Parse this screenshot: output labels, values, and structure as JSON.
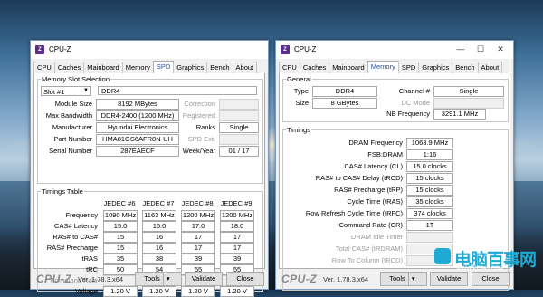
{
  "left": {
    "title": "CPU-Z",
    "tabs": [
      "CPU",
      "Caches",
      "Mainboard",
      "Memory",
      "SPD",
      "Graphics",
      "Bench",
      "About"
    ],
    "active_tab": "SPD",
    "slot_section": "Memory Slot Selection",
    "slot": {
      "value": "Slot #1",
      "type": "DDR4"
    },
    "labels": {
      "module_size": "Module Size",
      "max_bandwidth": "Max Bandwidth",
      "manufacturer": "Manufacturer",
      "part_number": "Part Number",
      "serial_number": "Serial Number",
      "correction": "Correction",
      "registered": "Registered",
      "ranks": "Ranks",
      "spd_ext": "SPD Ext.",
      "week_year": "Week/Year"
    },
    "values": {
      "module_size": "8192 MBytes",
      "max_bandwidth": "DDR4-2400 (1200 MHz)",
      "manufacturer": "Hyundai Electronics",
      "part_number": "HMA81GS6AFR8N-UH",
      "serial_number": "287EAECF",
      "ranks": "Single",
      "week_year": "01 / 17"
    },
    "timings_section": "Timings Table",
    "timing_headers": [
      "JEDEC #6",
      "JEDEC #7",
      "JEDEC #8",
      "JEDEC #9"
    ],
    "timing_rows": [
      {
        "label": "Frequency",
        "values": [
          "1090 MHz",
          "1163 MHz",
          "1200 MHz",
          "1200 MHz"
        ],
        "dim": false
      },
      {
        "label": "CAS# Latency",
        "values": [
          "15.0",
          "16.0",
          "17.0",
          "18.0"
        ],
        "dim": false
      },
      {
        "label": "RAS# to CAS#",
        "values": [
          "15",
          "16",
          "17",
          "17"
        ],
        "dim": false
      },
      {
        "label": "RAS# Precharge",
        "values": [
          "15",
          "16",
          "17",
          "17"
        ],
        "dim": false
      },
      {
        "label": "tRAS",
        "values": [
          "35",
          "38",
          "39",
          "39"
        ],
        "dim": false
      },
      {
        "label": "tRC",
        "values": [
          "50",
          "54",
          "55",
          "55"
        ],
        "dim": false
      },
      {
        "label": "Command Rate",
        "values": [
          "",
          "",
          "",
          ""
        ],
        "dim": true
      },
      {
        "label": "Voltage",
        "values": [
          "1.20 V",
          "1.20 V",
          "1.20 V",
          "1.20 V"
        ],
        "dim": false
      }
    ],
    "footer": {
      "brand": "CPU-Z",
      "version": "Ver. 1.78.3.x64",
      "tools": "Tools",
      "validate": "Validate",
      "close": "Close"
    }
  },
  "right": {
    "title": "CPU-Z",
    "tabs": [
      "CPU",
      "Caches",
      "Mainboard",
      "Memory",
      "SPD",
      "Graphics",
      "Bench",
      "About"
    ],
    "active_tab": "Memory",
    "general_section": "General",
    "general": {
      "type_label": "Type",
      "type": "DDR4",
      "size_label": "Size",
      "size": "8 GBytes",
      "channel_label": "Channel #",
      "channel": "Single",
      "dc_mode_label": "DC Mode",
      "dc_mode": "",
      "nb_freq_label": "NB Frequency",
      "nb_freq": "3291.1 MHz"
    },
    "timings_section": "Timings",
    "timings": [
      {
        "label": "DRAM Frequency",
        "value": "1063.9 MHz",
        "dim": false
      },
      {
        "label": "FSB:DRAM",
        "value": "1:16",
        "dim": false
      },
      {
        "label": "CAS# Latency (CL)",
        "value": "15.0 clocks",
        "dim": false
      },
      {
        "label": "RAS# to CAS# Delay (tRCD)",
        "value": "15 clocks",
        "dim": false
      },
      {
        "label": "RAS# Precharge (tRP)",
        "value": "15 clocks",
        "dim": false
      },
      {
        "label": "Cycle Time (tRAS)",
        "value": "35 clocks",
        "dim": false
      },
      {
        "label": "Row Refresh Cycle Time (tRFC)",
        "value": "374 clocks",
        "dim": false
      },
      {
        "label": "Command Rate (CR)",
        "value": "1T",
        "dim": false
      },
      {
        "label": "DRAM Idle Timer",
        "value": "",
        "dim": true
      },
      {
        "label": "Total CAS# (tRDRAM)",
        "value": "",
        "dim": true
      },
      {
        "label": "Row To Column (tRCD)",
        "value": "",
        "dim": true
      }
    ],
    "footer": {
      "brand": "CPU-Z",
      "version": "Ver. 1.78.3.x64",
      "tools": "Tools",
      "validate": "Validate",
      "close": "Close"
    }
  },
  "watermark": {
    "text": "电脑百事网",
    "url": "WWW.PC841.COM"
  }
}
